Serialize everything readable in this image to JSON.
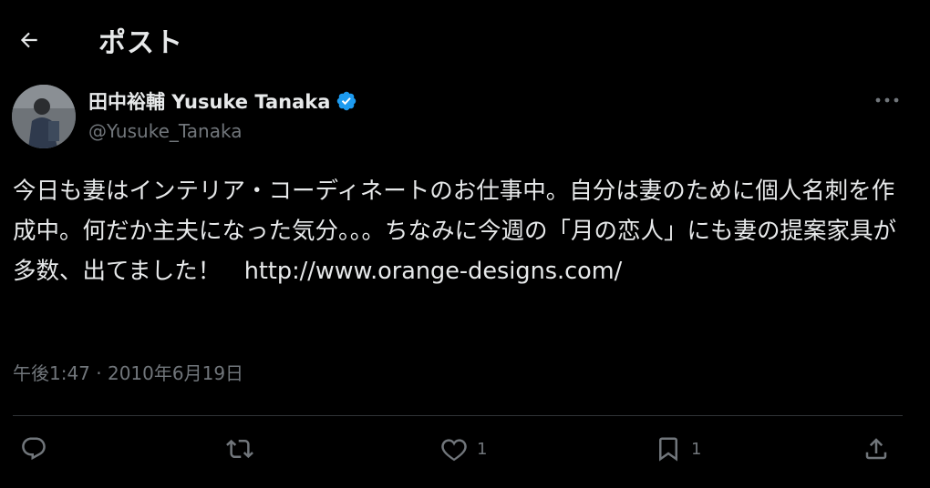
{
  "header": {
    "back_icon": "arrow-left-icon",
    "title": "ポスト"
  },
  "author": {
    "display_name": "田中裕輔 Yusuke Tanaka",
    "handle": "@Yusuke_Tanaka",
    "verified": true,
    "verified_color": "#1d9bf0"
  },
  "tweet": {
    "text": "今日も妻はインテリア・コーディネートのお仕事中。自分は妻のために個人名刺を作成中。何だか主夫になった気分。。。ちなみに今週の「月の恋人」にも妻の提案家具が多数、出てました！　",
    "link": "http://www.orange-designs.com/",
    "timestamp": "午後1:47 · 2010年6月19日"
  },
  "actions": {
    "reply": {
      "icon": "reply-icon",
      "count": ""
    },
    "repost": {
      "icon": "repost-icon",
      "count": ""
    },
    "like": {
      "icon": "heart-icon",
      "count": "1"
    },
    "bookmark": {
      "icon": "bookmark-icon",
      "count": "1"
    },
    "share": {
      "icon": "share-icon",
      "count": ""
    }
  },
  "colors": {
    "background": "#000000",
    "text": "#e7e9ea",
    "muted": "#71767b",
    "divider": "#2f3336"
  }
}
